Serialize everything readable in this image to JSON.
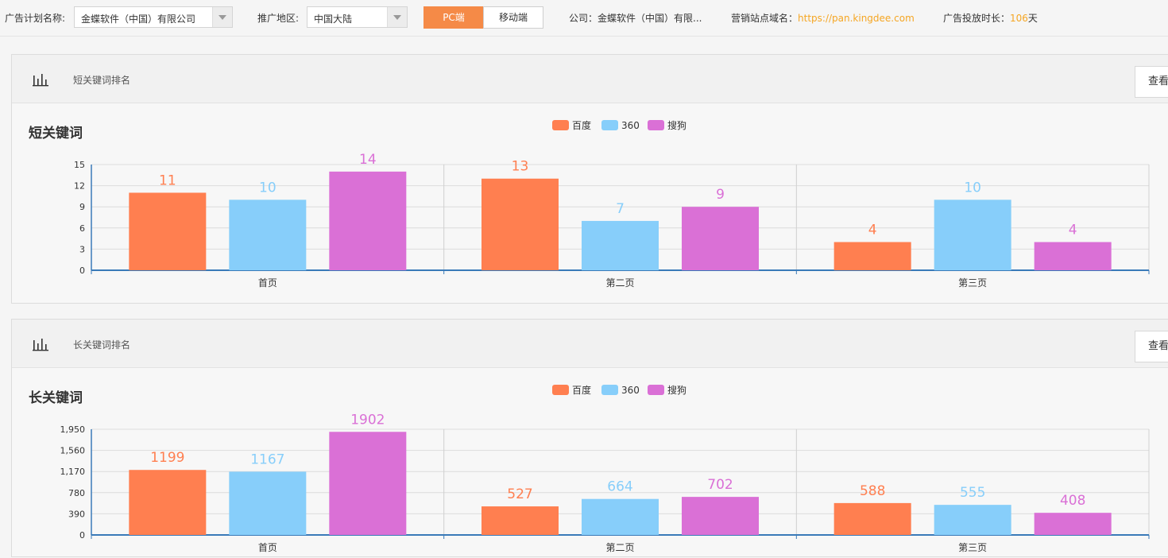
{
  "topbar": {
    "plan_label": "广告计划名称:",
    "plan_value": "金蝶软件（中国）有限公司",
    "region_label": "推广地区:",
    "region_value": "中国大陆",
    "pc_label": "PC端",
    "mobile_label": "移动端",
    "company_text": "公司：金蝶软件（中国）有限...",
    "domain_label": "营销站点域名：",
    "domain_value": "https://pan.kingdee.com",
    "duration_label": "广告投放时长：",
    "duration_value": "106",
    "duration_unit": "天"
  },
  "cards": [
    {
      "header_title": "短关键词排名",
      "view_label": "查看",
      "chart_title": "短关键词"
    },
    {
      "header_title": "长关键词排名",
      "view_label": "查看",
      "chart_title": "长关键词"
    }
  ],
  "colors": {
    "baidu": "#ff7f50",
    "s360": "#87cefa",
    "sogou": "#da70d6",
    "accent": "#f58a47"
  },
  "chart_data": [
    {
      "type": "bar",
      "categories": [
        "首页",
        "第二页",
        "第三页"
      ],
      "series": [
        {
          "name": "百度",
          "values": [
            11,
            13,
            4
          ]
        },
        {
          "name": "360",
          "values": [
            10,
            7,
            10
          ]
        },
        {
          "name": "搜狗",
          "values": [
            14,
            9,
            4
          ]
        }
      ],
      "yticks": [
        0,
        3,
        6,
        9,
        12,
        15
      ],
      "ytick_labels": [
        "0",
        "3",
        "6",
        "9",
        "12",
        "15"
      ],
      "ylim": [
        0,
        15
      ],
      "grid": true,
      "legend": "top-center"
    },
    {
      "type": "bar",
      "categories": [
        "首页",
        "第二页",
        "第三页"
      ],
      "series": [
        {
          "name": "百度",
          "values": [
            1199,
            527,
            588
          ]
        },
        {
          "name": "360",
          "values": [
            1167,
            664,
            555
          ]
        },
        {
          "name": "搜狗",
          "values": [
            1902,
            702,
            408
          ]
        }
      ],
      "yticks": [
        0,
        390,
        780,
        1170,
        1560,
        1950
      ],
      "ytick_labels": [
        "0",
        "390",
        "780",
        "1,170",
        "1,560",
        "1,950"
      ],
      "ylim": [
        0,
        1950
      ],
      "grid": true,
      "legend": "top-center"
    }
  ]
}
